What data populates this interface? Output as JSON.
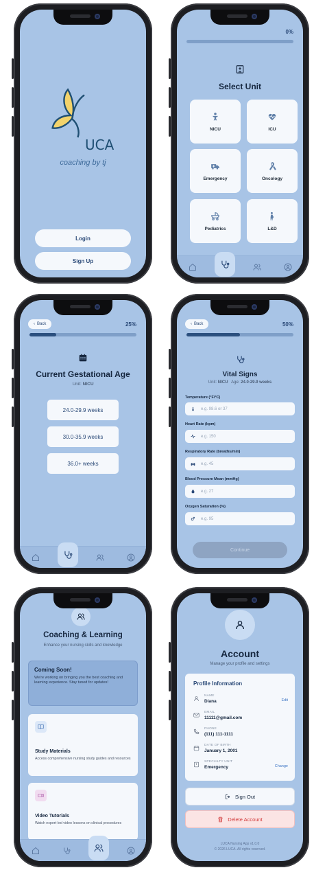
{
  "colors": {
    "screen_bg": "#a8c4e6",
    "accent": "#2b4a78",
    "card": "#f5f8fc",
    "delete_bg": "#fbe4e4",
    "delete_text": "#d23b3b"
  },
  "login": {
    "brand": "UCA",
    "tagline": "coaching by tj",
    "login_label": "Login",
    "signup_label": "Sign Up"
  },
  "select_unit": {
    "progress_text": "0%",
    "progress_value": 0,
    "title": "Select Unit",
    "units": [
      {
        "label": "NICU",
        "icon": "baby-icon"
      },
      {
        "label": "ICU",
        "icon": "heart-pulse-icon"
      },
      {
        "label": "Emergency",
        "icon": "ambulance-icon"
      },
      {
        "label": "Oncology",
        "icon": "ribbon-icon"
      },
      {
        "label": "Pediatrics",
        "icon": "stroller-icon"
      },
      {
        "label": "L&D",
        "icon": "pregnant-icon"
      }
    ]
  },
  "gestational": {
    "back_label": "Back",
    "progress_text": "25%",
    "progress_value": 0.25,
    "title": "Current Gestational Age",
    "unit_prefix": "Unit:",
    "unit_value": "NICU",
    "options": [
      "24.0-29.9 weeks",
      "30.0-35.9 weeks",
      "36.0+ weeks"
    ]
  },
  "vitals": {
    "back_label": "Back",
    "progress_text": "50%",
    "progress_value": 0.5,
    "title": "Vital Signs",
    "unit_prefix": "Unit:",
    "unit_value": "NICU",
    "age_prefix": "Age:",
    "age_value": "24.0-29.9 weeks",
    "fields": [
      {
        "label": "Temperature (°F/°C)",
        "placeholder": "e.g. 98.6 or 37",
        "icon": "thermometer-icon"
      },
      {
        "label": "Heart Rate (bpm)",
        "placeholder": "e.g. 150",
        "icon": "pulse-icon"
      },
      {
        "label": "Respiratory Rate (breaths/min)",
        "placeholder": "e.g. 45",
        "icon": "lungs-icon"
      },
      {
        "label": "Blood Pressure Mean (mmHg)",
        "placeholder": "e.g. 27",
        "icon": "droplet-icon"
      },
      {
        "label": "Oxygen Saturation (%)",
        "placeholder": "e.g. 95",
        "icon": "o2-icon"
      }
    ],
    "continue_label": "Continue"
  },
  "coaching": {
    "title": "Coaching & Learning",
    "subtitle": "Enhance your nursing skills and knowledge",
    "coming_soon_title": "Coming Soon!",
    "coming_soon_text": "We're working on bringing you the best coaching and learning experience. Stay tuned for updates!",
    "cards": [
      {
        "title": "Study Materials",
        "desc": "Access comprehensive nursing study guides and resources",
        "icon": "book-icon"
      },
      {
        "title": "Video Tutorials",
        "desc": "Watch expert-led video lessons on clinical procedures",
        "icon": "video-icon"
      }
    ]
  },
  "account": {
    "title": "Account",
    "subtitle": "Manage your profile and settings",
    "section_title": "Profile Information",
    "rows": [
      {
        "key": "NAME",
        "value": "Diana",
        "link": "Edit",
        "icon": "user-icon"
      },
      {
        "key": "EMAIL",
        "value": "11111@gmail.com",
        "link": "",
        "icon": "mail-icon"
      },
      {
        "key": "PHONE",
        "value": "(111) 111-1111",
        "link": "",
        "icon": "phone-icon"
      },
      {
        "key": "DATE OF BIRTH",
        "value": "January 1, 2001",
        "link": "",
        "icon": "calendar-icon"
      },
      {
        "key": "SPECIALTY UNIT",
        "value": "Emergency",
        "link": "Change",
        "icon": "hospital-icon"
      }
    ],
    "signout_label": "Sign Out",
    "delete_label": "Delete Account",
    "footer_1": "LUCA Nursing App v1.0.0",
    "footer_2": "© 2026 LUCA. All rights reserved."
  }
}
